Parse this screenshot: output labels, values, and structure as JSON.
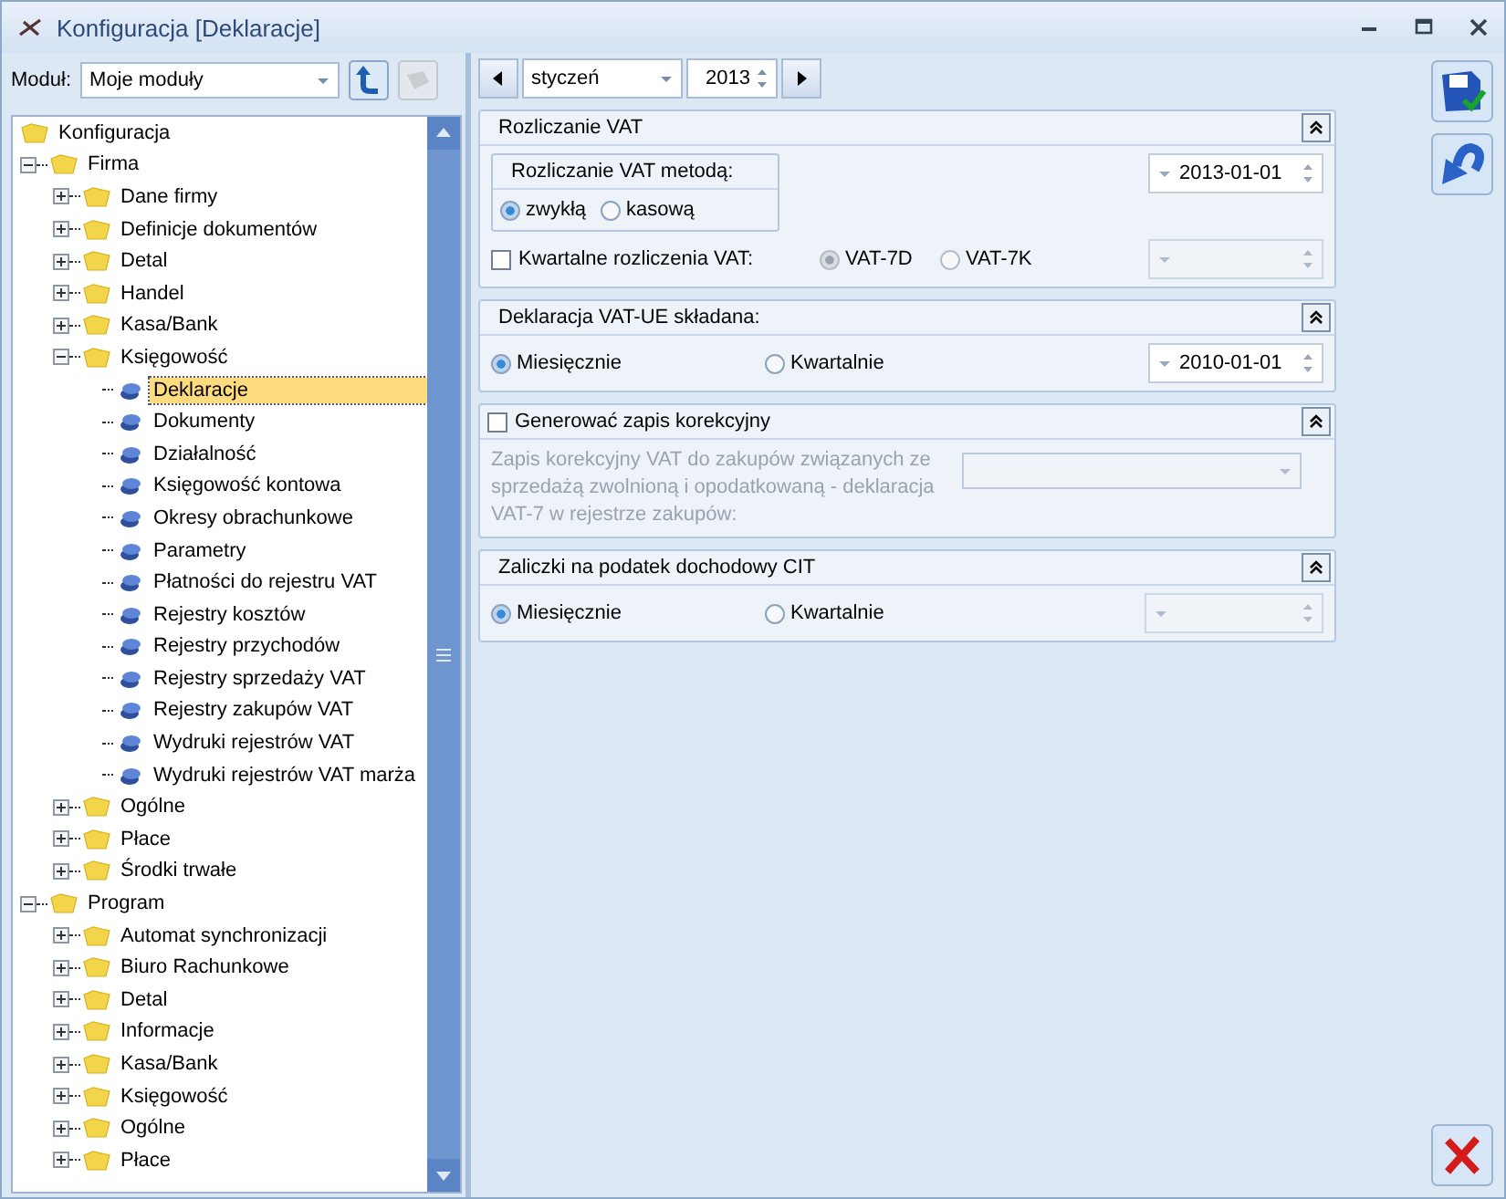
{
  "window": {
    "title": "Konfiguracja [Deklaracje]"
  },
  "module": {
    "label": "Moduł:",
    "value": "Moje moduły"
  },
  "tree": [
    {
      "label": "Konfiguracja",
      "kind": "folder",
      "selected": false,
      "children": [
        {
          "label": "Firma",
          "kind": "folder",
          "expanded": true,
          "selected": false,
          "children": [
            {
              "label": "Dane firmy",
              "kind": "folder",
              "expanded": false,
              "selected": false
            },
            {
              "label": "Definicje dokumentów",
              "kind": "folder",
              "expanded": false,
              "selected": false
            },
            {
              "label": "Detal",
              "kind": "folder",
              "expanded": false,
              "selected": false
            },
            {
              "label": "Handel",
              "kind": "folder",
              "expanded": false,
              "selected": false
            },
            {
              "label": "Kasa/Bank",
              "kind": "folder",
              "expanded": false,
              "selected": false
            },
            {
              "label": "Księgowość",
              "kind": "folder",
              "expanded": true,
              "selected": false,
              "children": [
                {
                  "label": "Deklaracje",
                  "kind": "leaf",
                  "selected": true
                },
                {
                  "label": "Dokumenty",
                  "kind": "leaf",
                  "selected": false
                },
                {
                  "label": "Działalność",
                  "kind": "leaf",
                  "selected": false
                },
                {
                  "label": "Księgowość kontowa",
                  "kind": "leaf",
                  "selected": false
                },
                {
                  "label": "Okresy obrachunkowe",
                  "kind": "leaf",
                  "selected": false
                },
                {
                  "label": "Parametry",
                  "kind": "leaf",
                  "selected": false
                },
                {
                  "label": "Płatności do rejestru VAT",
                  "kind": "leaf",
                  "selected": false
                },
                {
                  "label": "Rejestry kosztów",
                  "kind": "leaf",
                  "selected": false
                },
                {
                  "label": "Rejestry przychodów",
                  "kind": "leaf",
                  "selected": false
                },
                {
                  "label": "Rejestry sprzedaży VAT",
                  "kind": "leaf",
                  "selected": false
                },
                {
                  "label": "Rejestry zakupów VAT",
                  "kind": "leaf",
                  "selected": false
                },
                {
                  "label": "Wydruki rejestrów VAT",
                  "kind": "leaf",
                  "selected": false
                },
                {
                  "label": "Wydruki rejestrów VAT marża",
                  "kind": "leaf",
                  "selected": false
                }
              ]
            },
            {
              "label": "Ogólne",
              "kind": "folder",
              "expanded": false,
              "selected": false
            },
            {
              "label": "Płace",
              "kind": "folder",
              "expanded": false,
              "selected": false
            },
            {
              "label": "Środki trwałe",
              "kind": "folder",
              "expanded": false,
              "selected": false
            }
          ]
        },
        {
          "label": "Program",
          "kind": "folder",
          "expanded": true,
          "selected": false,
          "children": [
            {
              "label": "Automat synchronizacji",
              "kind": "folder",
              "expanded": false,
              "selected": false
            },
            {
              "label": "Biuro Rachunkowe",
              "kind": "folder",
              "expanded": false,
              "selected": false
            },
            {
              "label": "Detal",
              "kind": "folder",
              "expanded": false,
              "selected": false
            },
            {
              "label": "Informacje",
              "kind": "folder",
              "expanded": false,
              "selected": false
            },
            {
              "label": "Kasa/Bank",
              "kind": "folder",
              "expanded": false,
              "selected": false
            },
            {
              "label": "Księgowość",
              "kind": "folder",
              "expanded": false,
              "selected": false
            },
            {
              "label": "Ogólne",
              "kind": "folder",
              "expanded": false,
              "selected": false
            },
            {
              "label": "Płace",
              "kind": "folder",
              "expanded": false,
              "selected": false
            }
          ]
        }
      ]
    }
  ],
  "period": {
    "month": "styczeń",
    "year": "2013"
  },
  "vat_settlement": {
    "title": "Rozliczanie VAT",
    "method_title": "Rozliczanie VAT metodą:",
    "methods": [
      {
        "label": "zwykłą",
        "selected": true
      },
      {
        "label": "kasową",
        "selected": false
      }
    ],
    "date": "2013-01-01",
    "quarterly": {
      "label": "Kwartalne rozliczenia VAT:",
      "checked": false
    },
    "forms": [
      {
        "label": "VAT-7D",
        "selected": true,
        "disabled": true
      },
      {
        "label": "VAT-7K",
        "selected": false,
        "disabled": true
      }
    ],
    "form_date_disabled": true
  },
  "vat_ue": {
    "title": "Deklaracja VAT-UE składana:",
    "options": [
      {
        "label": "Miesięcznie",
        "selected": true
      },
      {
        "label": "Kwartalnie",
        "selected": false
      }
    ],
    "date": "2010-01-01"
  },
  "correction": {
    "label": "Generować zapis korekcyjny",
    "checked": false,
    "note": "Zapis korekcyjny VAT do zakupów związanych ze sprzedażą zwolnioną i opodatkowaną - deklaracja VAT-7 w rejestrze zakupów:",
    "disabled": true
  },
  "cit": {
    "title": "Zaliczki na podatek dochodowy CIT",
    "options": [
      {
        "label": "Miesięcznie",
        "selected": true
      },
      {
        "label": "Kwartalnie",
        "selected": false
      }
    ],
    "date_disabled": true
  }
}
